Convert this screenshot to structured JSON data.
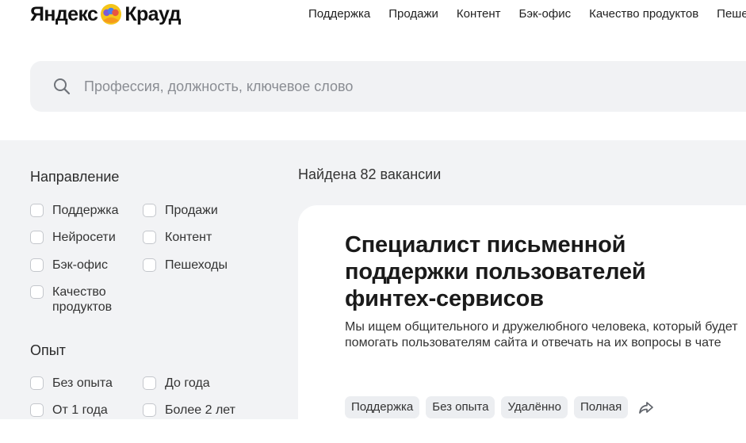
{
  "header": {
    "logo_left": "Яндекс",
    "logo_right": "Крауд",
    "nav": [
      "Поддержка",
      "Продажи",
      "Контент",
      "Бэк-офис",
      "Качество продуктов",
      "Пешеходы"
    ]
  },
  "search": {
    "placeholder": "Профессия, должность, ключевое слово",
    "icon": "search-icon"
  },
  "filters": {
    "direction": {
      "title": "Направление",
      "options": [
        "Поддержка",
        "Продажи",
        "Нейросети",
        "Контент",
        "Бэк-офис",
        "Пешеходы",
        "Качество продуктов"
      ]
    },
    "experience": {
      "title": "Опыт",
      "options": [
        "Без опыта",
        "До года",
        "От 1 года",
        "Более 2 лет"
      ]
    }
  },
  "results": {
    "found": "Найдена 82 вакансии"
  },
  "vacancy": {
    "title": "Специалист письменной поддержки пользователей финтех-сервисов",
    "description": "Мы ищем общительного и дружелюбного человека, который будет помогать пользователям сайта и отвечать на их вопросы в чате",
    "tags": [
      "Поддержка",
      "Без опыта",
      "Удалённо",
      "Полная"
    ],
    "share_icon": "share-icon"
  },
  "colors": {
    "background": "#ffffff",
    "panel": "#f2f3f5",
    "search_bg": "#f1f2f4",
    "tag_bg": "#eceef1"
  }
}
